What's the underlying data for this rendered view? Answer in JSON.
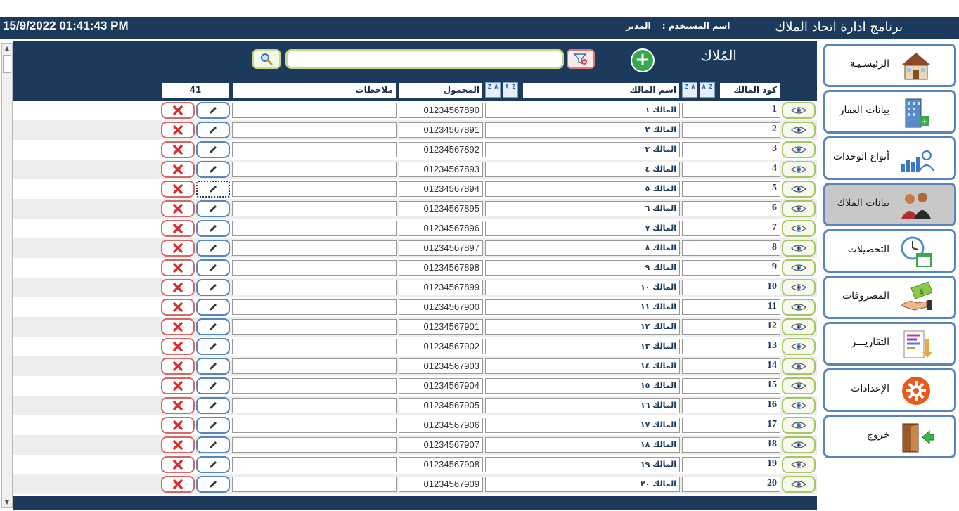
{
  "header": {
    "datetime": "15/9/2022 01:41:43 PM",
    "user_label": "اسم المستخدم :",
    "user_name": "المدير",
    "app_title": "برنامج ادارة اتحاد الملاك"
  },
  "page": {
    "title": "المُلاك",
    "search_value": "",
    "count": "41"
  },
  "columns": {
    "code": "كود المالك",
    "name": "اسم المالك",
    "mobile": "المحمول",
    "notes": "ملاحظات"
  },
  "sort": {
    "asc": "A Z",
    "desc": "Z A"
  },
  "rows": [
    {
      "code": "1",
      "name": "المالك ١",
      "mobile": "01234567890",
      "notes": ""
    },
    {
      "code": "2",
      "name": "المالك ٢",
      "mobile": "01234567891",
      "notes": ""
    },
    {
      "code": "3",
      "name": "المالك ٣",
      "mobile": "01234567892",
      "notes": ""
    },
    {
      "code": "4",
      "name": "المالك ٤",
      "mobile": "01234567893",
      "notes": ""
    },
    {
      "code": "5",
      "name": "المالك ٥",
      "mobile": "01234567894",
      "notes": ""
    },
    {
      "code": "6",
      "name": "المالك ٦",
      "mobile": "01234567895",
      "notes": ""
    },
    {
      "code": "7",
      "name": "المالك ٧",
      "mobile": "01234567896",
      "notes": ""
    },
    {
      "code": "8",
      "name": "المالك ٨",
      "mobile": "01234567897",
      "notes": ""
    },
    {
      "code": "9",
      "name": "المالك ٩",
      "mobile": "01234567898",
      "notes": ""
    },
    {
      "code": "10",
      "name": "المالك ١٠",
      "mobile": "01234567899",
      "notes": ""
    },
    {
      "code": "11",
      "name": "المالك ١١",
      "mobile": "01234567900",
      "notes": ""
    },
    {
      "code": "12",
      "name": "المالك ١٢",
      "mobile": "01234567901",
      "notes": ""
    },
    {
      "code": "13",
      "name": "المالك ١٣",
      "mobile": "01234567902",
      "notes": ""
    },
    {
      "code": "14",
      "name": "المالك ١٤",
      "mobile": "01234567903",
      "notes": ""
    },
    {
      "code": "15",
      "name": "المالك ١٥",
      "mobile": "01234567904",
      "notes": ""
    },
    {
      "code": "16",
      "name": "المالك ١٦",
      "mobile": "01234567905",
      "notes": ""
    },
    {
      "code": "17",
      "name": "المالك ١٧",
      "mobile": "01234567906",
      "notes": ""
    },
    {
      "code": "18",
      "name": "المالك ١٨",
      "mobile": "01234567907",
      "notes": ""
    },
    {
      "code": "19",
      "name": "المالك ١٩",
      "mobile": "01234567908",
      "notes": ""
    },
    {
      "code": "20",
      "name": "المالك ٢٠",
      "mobile": "01234567909",
      "notes": ""
    }
  ],
  "nav": [
    {
      "label": "الرئيسـيـة",
      "icon": "house-icon"
    },
    {
      "label": "بيانات العقار",
      "icon": "building-icon"
    },
    {
      "label": "أنواع الوحدات",
      "icon": "chart-user-icon"
    },
    {
      "label": "بيانات الملاك",
      "icon": "people-icon"
    },
    {
      "label": "التحصيلات",
      "icon": "clock-calendar-icon"
    },
    {
      "label": "المصروفات",
      "icon": "money-hand-icon"
    },
    {
      "label": "التقاريـــر",
      "icon": "report-icon"
    },
    {
      "label": "الإعدادات",
      "icon": "gear-icon"
    },
    {
      "label": "خروج",
      "icon": "exit-door-icon"
    }
  ],
  "active_nav": 3,
  "colors": {
    "navy": "#1b3a5c",
    "view_border": "#a8c468",
    "edit_border": "#5a84bc",
    "delete_border": "#d06a6a"
  }
}
